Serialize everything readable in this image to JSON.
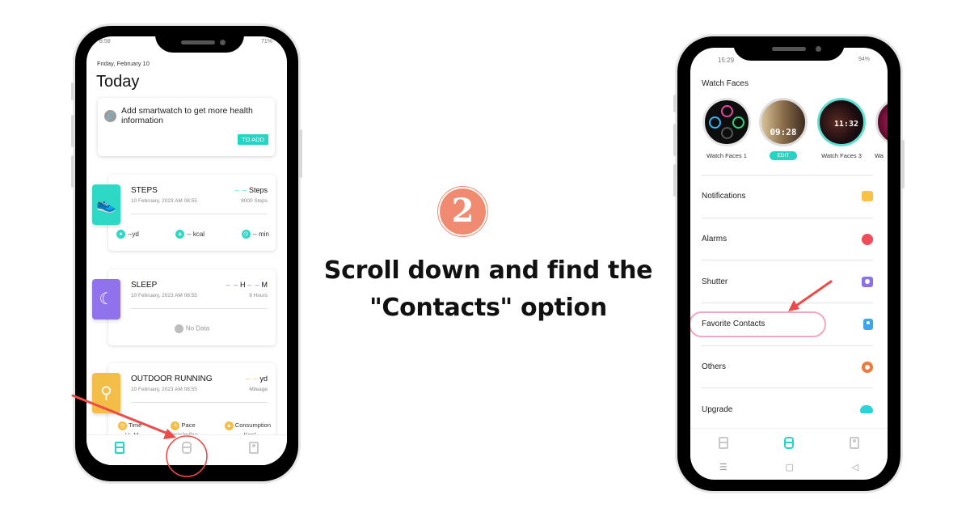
{
  "left_phone": {
    "status": {
      "time": "8:58",
      "battery": "71%"
    },
    "date": "Friday, February 10",
    "title": "Today",
    "add_card": {
      "message": "Add smartwatch to get more health information",
      "button": "TO ADD",
      "icon": "link-icon"
    },
    "cards": {
      "steps": {
        "title": "STEPS",
        "date": "10 February, 2023 AM 08:55",
        "value_dash": "– –",
        "value_unit": "Steps",
        "goal": "8000 Steps",
        "color": "#2dd9c5",
        "stats": [
          {
            "icon": "location-icon",
            "text": "--yd"
          },
          {
            "icon": "flame-icon",
            "text": "-- kcal"
          },
          {
            "icon": "clock-icon",
            "text": "-- min"
          }
        ]
      },
      "sleep": {
        "title": "SLEEP",
        "date": "10 February, 2023 AM 08:55",
        "value_dash_h": "– –",
        "unit_h": "H",
        "value_dash_m": "– –",
        "unit_m": "M",
        "goal": "8 Hours",
        "no_data": "No Data",
        "color": "#8f72ec"
      },
      "running": {
        "title": "OUTDOOR RUNNING",
        "date": "10 February, 2023 AM 08:55",
        "value_dash": "– –",
        "value_unit": "yd",
        "sub": "Mileage",
        "color": "#f4bd48",
        "stats": [
          {
            "icon": "clock-icon",
            "label": "Time",
            "value": "--H--M"
          },
          {
            "icon": "bolt-icon",
            "label": "Pace",
            "value": "--min/miles"
          },
          {
            "icon": "flame-icon",
            "label": "Consumption",
            "value": "--Kcal"
          }
        ]
      }
    },
    "tabs": [
      {
        "name": "health",
        "active": true
      },
      {
        "name": "device",
        "active": false
      },
      {
        "name": "profile",
        "active": false
      }
    ]
  },
  "center": {
    "step_number": "2",
    "instruction_line1": "Scroll down and find the",
    "instruction_line2": "\"Contacts\" option",
    "accent": "#f08a70"
  },
  "right_phone": {
    "status": {
      "time": "15:29",
      "battery": "94%"
    },
    "watch_faces_title": "Watch Faces",
    "watch_faces": [
      {
        "label": "Watch Faces 1"
      },
      {
        "label": "",
        "time": "09:28",
        "button": "EDIT"
      },
      {
        "label": "Watch Faces 3",
        "time": "11:32"
      },
      {
        "label": "Wa"
      }
    ],
    "menu": [
      {
        "label": "Notifications",
        "icon": "message-icon",
        "color": "#f7c245"
      },
      {
        "label": "Alarms",
        "icon": "alarm-clock-icon",
        "color": "#f04c5a"
      },
      {
        "label": "Shutter",
        "icon": "camera-icon",
        "color": "#8b72ec"
      },
      {
        "label": "Favorite Contacts",
        "icon": "contacts-icon",
        "color": "#3aa6f0"
      },
      {
        "label": "Others",
        "icon": "gear-icon",
        "color": "#f07a3c"
      },
      {
        "label": "Upgrade",
        "icon": "cloud-download-icon",
        "color": "#2ad3d6"
      }
    ],
    "tabs": [
      {
        "name": "health",
        "active": false
      },
      {
        "name": "device",
        "active": true
      },
      {
        "name": "profile",
        "active": false
      }
    ],
    "nav": {
      "menu": "☰",
      "home": "▢",
      "back": "◁"
    }
  }
}
